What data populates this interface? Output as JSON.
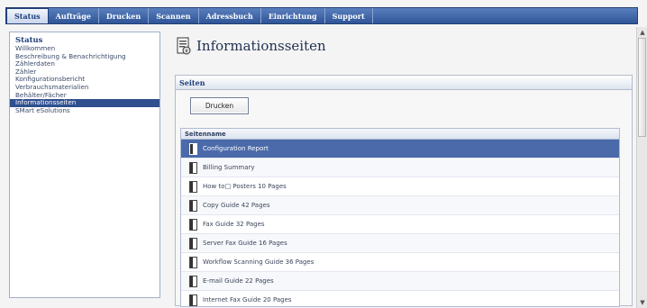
{
  "nav": {
    "tabs": [
      {
        "label": "Status",
        "active": true
      },
      {
        "label": "Aufträge"
      },
      {
        "label": "Drucken"
      },
      {
        "label": "Scannen"
      },
      {
        "label": "Adressbuch"
      },
      {
        "label": "Einrichtung"
      },
      {
        "label": "Support"
      }
    ]
  },
  "sidebar": {
    "title": "Status",
    "items": [
      {
        "label": "Willkommen"
      },
      {
        "label": "Beschreibung & Benachrichtigung"
      },
      {
        "label": "Zählerdaten"
      },
      {
        "label": "Zähler"
      },
      {
        "label": "Konfigurationsbericht"
      },
      {
        "label": "Verbrauchsmaterialien"
      },
      {
        "label": "Behälter/Fächer"
      },
      {
        "label": "Informationsseiten",
        "selected": true
      },
      {
        "label": "SMart eSolutions"
      }
    ]
  },
  "main": {
    "title": "Informationsseiten",
    "section_title": "Seiten",
    "print_button": "Drucken",
    "table": {
      "column_header": "Seitenname",
      "rows": [
        {
          "name": "Configuration Report",
          "selected": true
        },
        {
          "name": "Billing Summary"
        },
        {
          "name": "How to□ Posters 10 Pages"
        },
        {
          "name": "Copy Guide 42 Pages"
        },
        {
          "name": "Fax Guide 32 Pages"
        },
        {
          "name": "Server Fax Guide 16 Pages"
        },
        {
          "name": "Workflow Scanning Guide 36 Pages"
        },
        {
          "name": "E-mail Guide 22 Pages"
        },
        {
          "name": "Internet Fax Guide 20 Pages"
        }
      ]
    }
  },
  "colors": {
    "nav_bar": "#2f5597",
    "selected": "#4a6aaa",
    "title": "#1f3f7a"
  }
}
